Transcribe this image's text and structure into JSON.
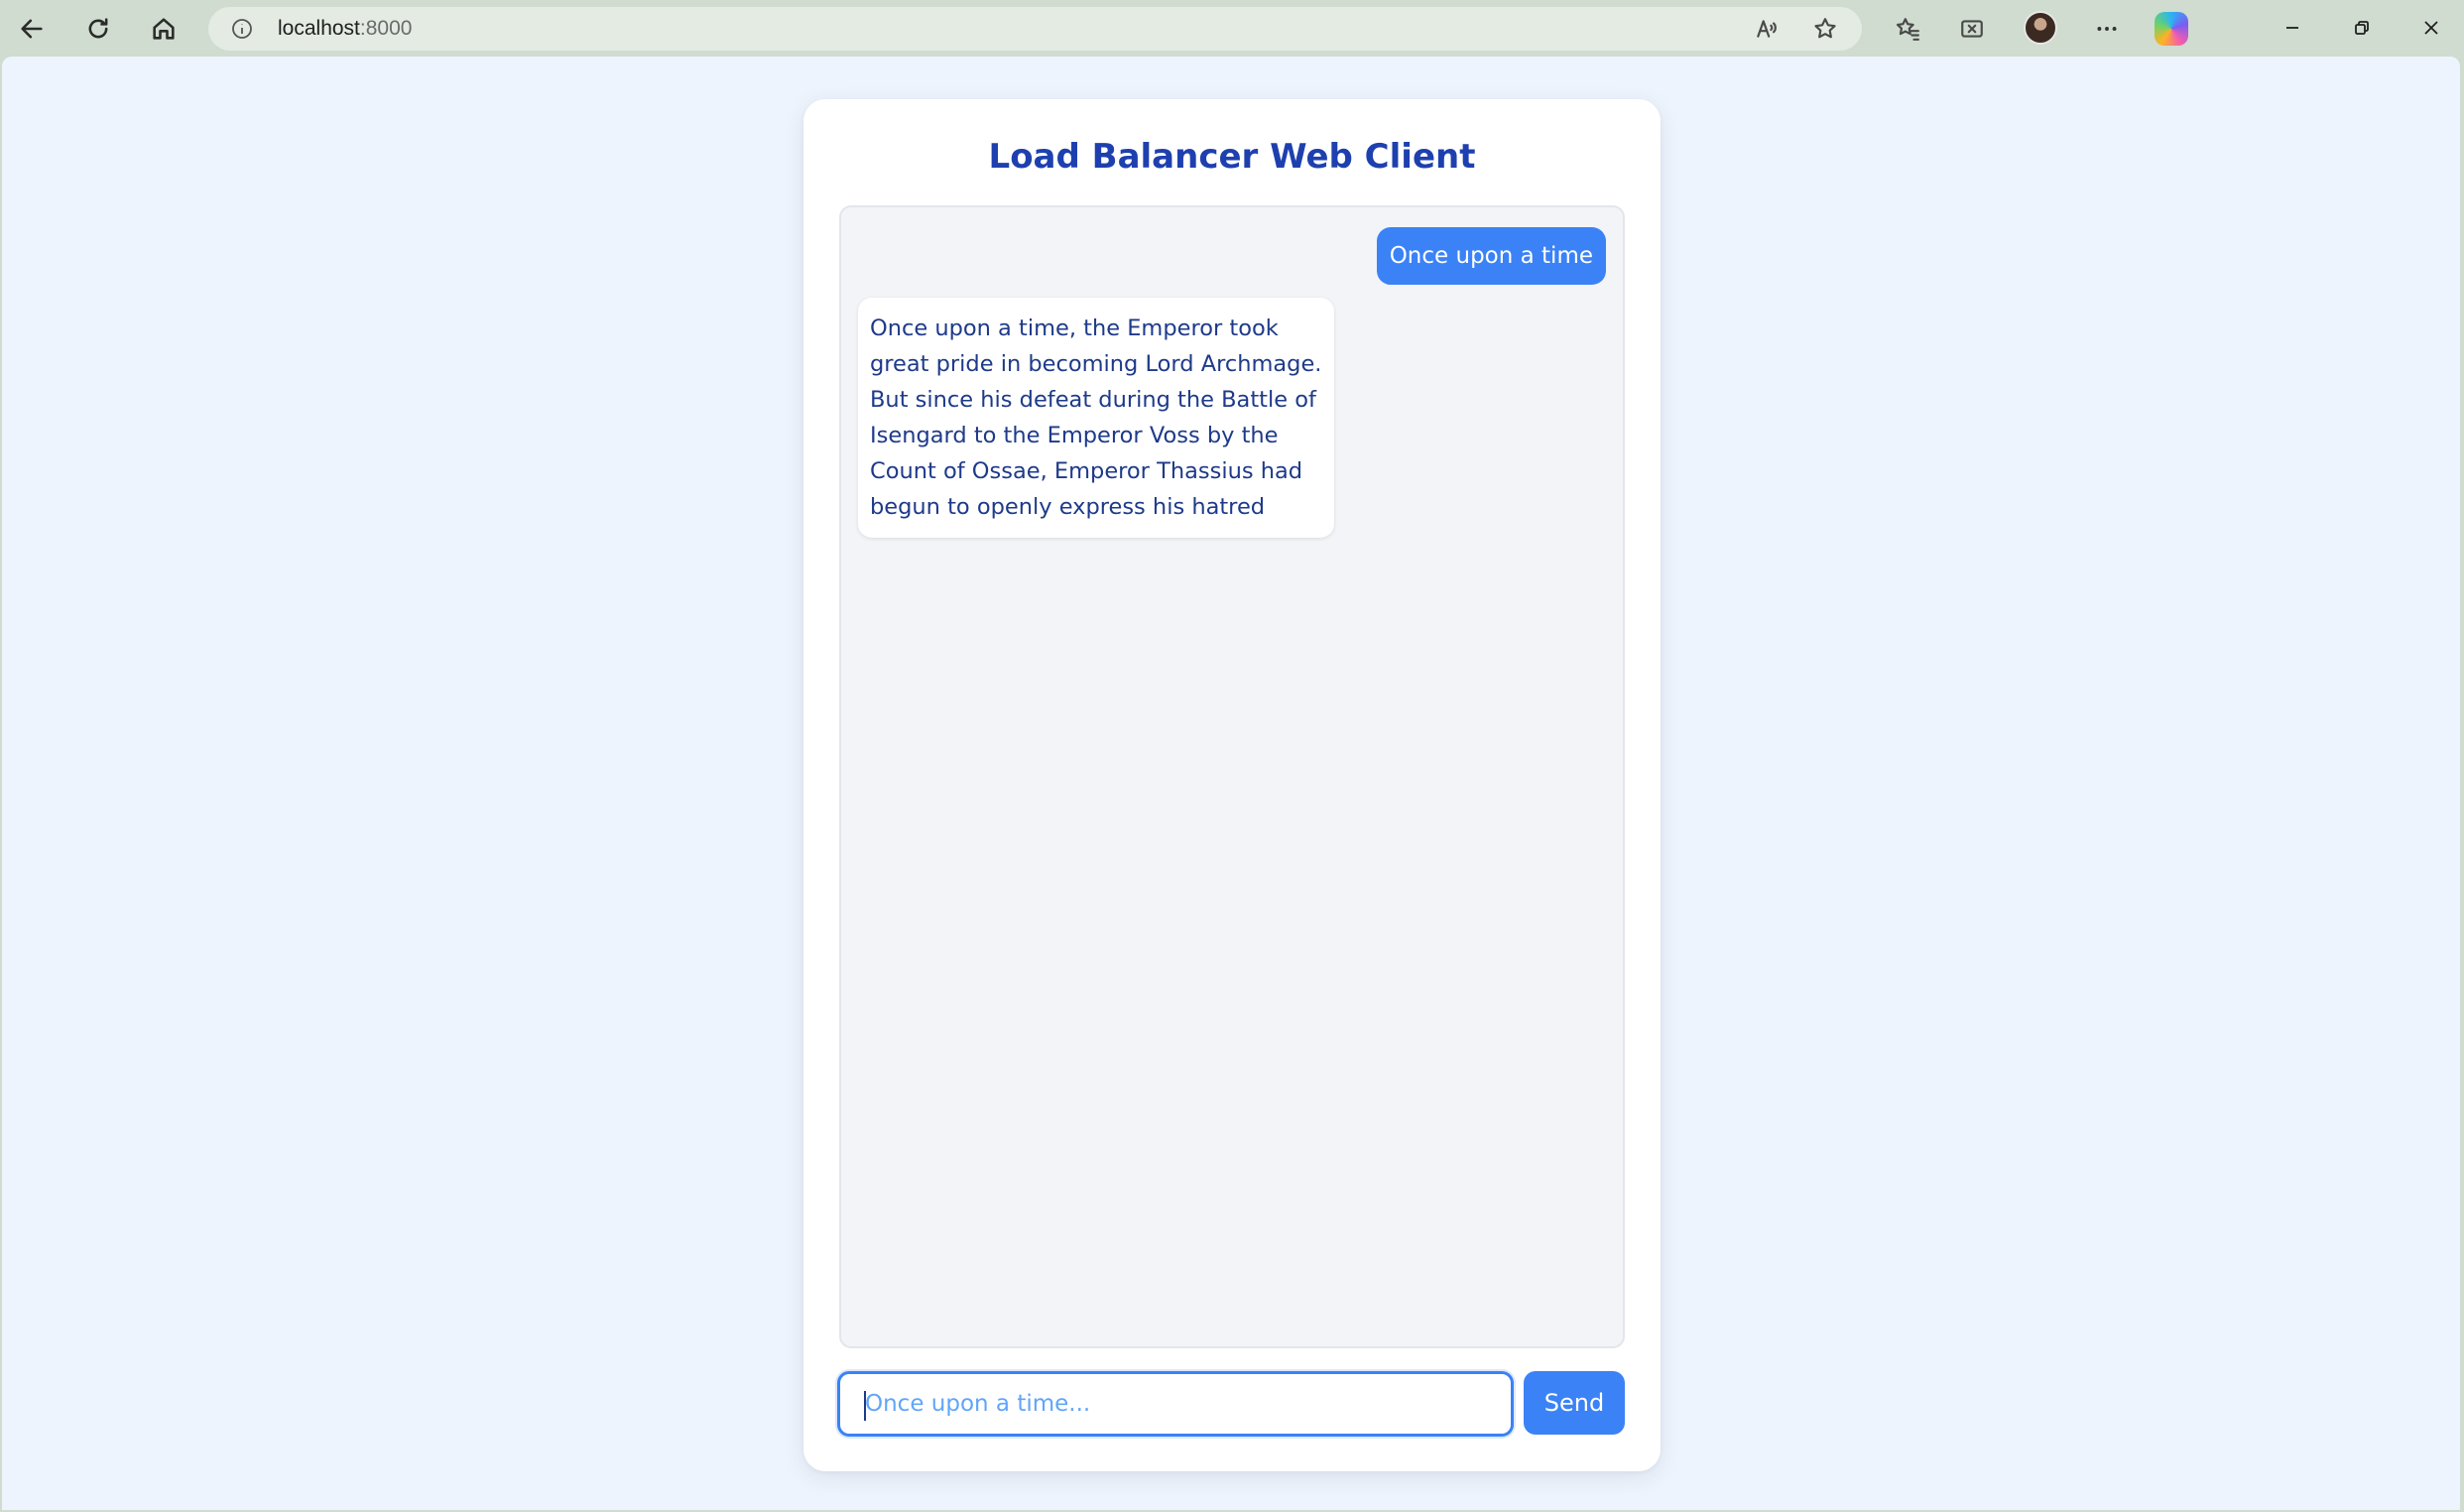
{
  "browser": {
    "url_host": "localhost",
    "url_port": ":8000",
    "icons": {
      "back": "arrow-left-icon",
      "refresh": "refresh-icon",
      "home": "home-icon",
      "site_info": "info-icon",
      "read_aloud": "read-aloud-icon",
      "favorite": "star-icon",
      "favorites": "favorites-icon",
      "screenshot": "screenshot-icon",
      "profile": "avatar",
      "more": "more-icon",
      "copilot": "copilot-icon",
      "minimize": "minimize-icon",
      "restore": "restore-icon",
      "close": "close-icon"
    }
  },
  "app": {
    "title": "Load Balancer Web Client",
    "messages": [
      {
        "role": "user",
        "text": "Once upon a time"
      },
      {
        "role": "assistant",
        "text": "Once upon a time, the Emperor took great pride in becoming Lord Archmage. But since his defeat during the Battle of Isengard to the Emperor Voss by the Count of Ossae, Emperor Thassius had begun to openly express his hatred"
      }
    ],
    "input": {
      "value": "",
      "placeholder": "Once upon a time..."
    },
    "send_label": "Send"
  },
  "colors": {
    "accent": "#3b82f6",
    "title": "#1e40af",
    "page_bg": "#eef4fd",
    "chrome_bg": "#cfdccf"
  }
}
